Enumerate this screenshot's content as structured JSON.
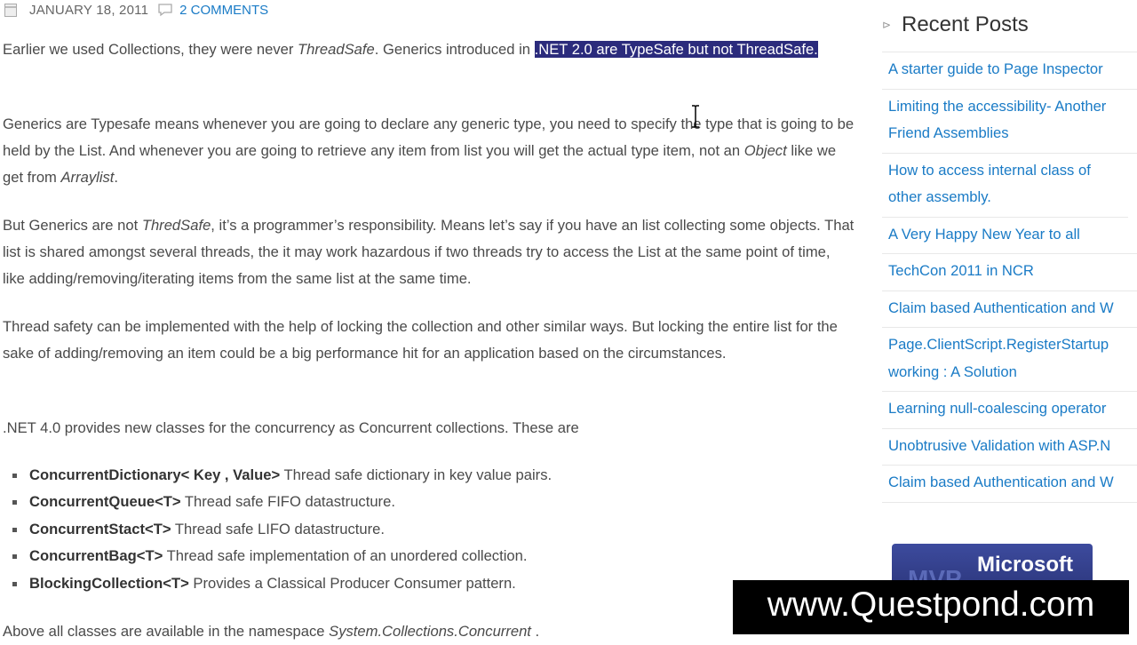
{
  "meta": {
    "date": "JANUARY 18, 2011",
    "comments": "2 COMMENTS"
  },
  "article": {
    "p1_start": "Earlier we used Collections, they were never ",
    "p1_threadsafe": "ThreadSafe",
    "p1_mid": ". Generics introduced in ",
    "p1_selected": ".NET 2.0 are TypeSafe but not ThreadSafe.",
    "p2_a": "Generics are Typesafe means whenever you are going to declare any generic type, you need to specify the type that is going to be held by the List. And whenever you are going to retrieve any item from list you will get the actual type item, not an ",
    "p2_object": "Object",
    "p2_b": " like we get from ",
    "p2_arraylist": "Arraylist",
    "p2_c": ".",
    "p3_a": "But Generics are not ",
    "p3_thredsafe": "ThredSafe",
    "p3_b": ", it’s a programmer’s responsibility. Means let’s say if you have an list collecting some objects. That list is shared amongst several threads, the it may work hazardous if two threads try to access the List at the same point of time, like adding/removing/iterating  items from the same list at the same time.",
    "p4": "Thread safety can be implemented with the help of locking the collection and other similar ways. But locking the entire list for the sake of adding/removing an item could be a big performance hit for an application based on the circumstances.",
    "p5": ".NET 4.0 provides new classes for the concurrency as Concurrent collections. These are",
    "bullets": [
      {
        "name": "ConcurrentDictionary< Key , Value>",
        "desc": " Thread safe dictionary in key value pairs."
      },
      {
        "name": "ConcurrentQueue<T>",
        "desc": " Thread safe FIFO datastructure."
      },
      {
        "name": "ConcurrentStact<T>",
        "desc": " Thread safe LIFO datastructure."
      },
      {
        "name": "ConcurrentBag<T>",
        "desc": " Thread safe implementation of an unordered collection."
      },
      {
        "name": "BlockingCollection<T>",
        "desc": " Provides a Classical Producer Consumer pattern."
      }
    ],
    "p6_a": "Above all classes are available in the namespace ",
    "p6_ns": "System.Collections.Concurrent",
    "p6_b": " ."
  },
  "sidebar": {
    "title": "Recent Posts",
    "posts": [
      "A starter guide to Page Inspector",
      "Limiting the accessibility- Another Friend Assemblies",
      "How to access internal class of other assembly.",
      "A Very Happy New Year to all",
      "TechCon 2011 in NCR",
      "Claim based Authentication and W",
      "Page.ClientScript.RegisterStartup working : A Solution",
      "Learning null-coalescing operator",
      "Unobtrusive Validation with ASP.N",
      "Claim based Authentication and W"
    ],
    "badge_mvp": "MVP",
    "badge_text": "Microsoft"
  },
  "watermark": "www.Questpond.com",
  "colors": {
    "link": "#1a7bc6",
    "selection": "#2b2b7c",
    "text": "#4a4a4a"
  }
}
